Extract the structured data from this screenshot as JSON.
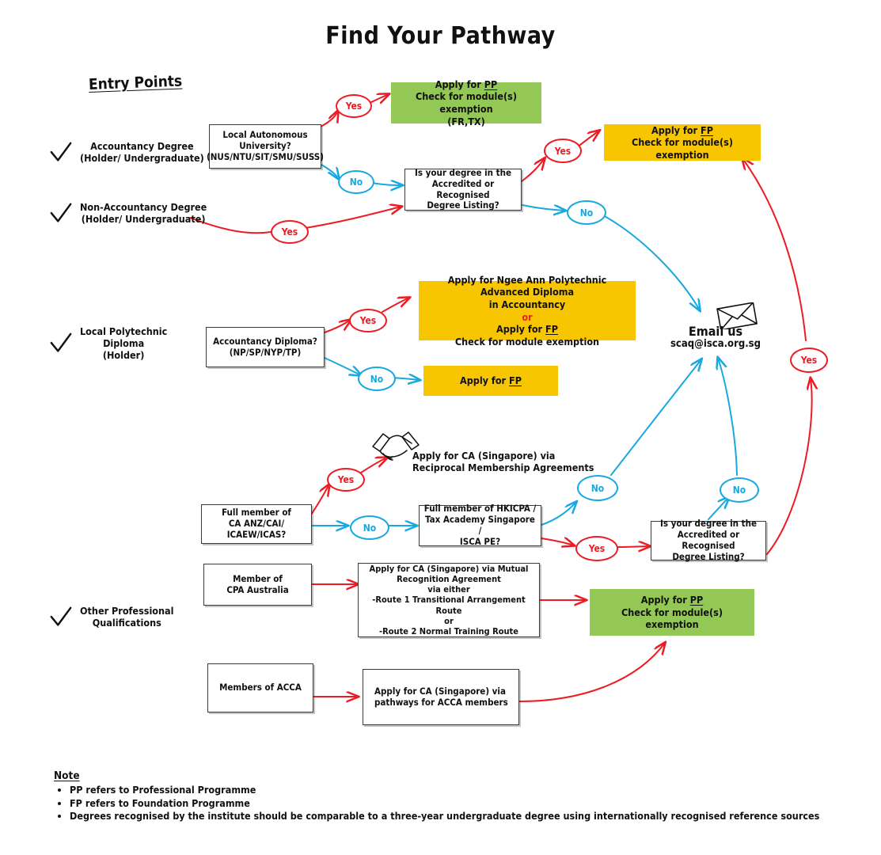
{
  "title": "Find Your Pathway",
  "entry_points_heading": "Entry Points",
  "entries": [
    {
      "id": "accountancy-degree",
      "label": "Accountancy Degree\n(Holder/ Undergraduate)"
    },
    {
      "id": "non-accountancy-degree",
      "label": "Non-Accountancy Degree\n(Holder/ Undergraduate)"
    },
    {
      "id": "local-polytechnic-diploma",
      "label": "Local Polytechnic\nDiploma\n(Holder)"
    },
    {
      "id": "other-professional-qualifications",
      "label": "Other Professional\nQualifications"
    }
  ],
  "boxes": {
    "local_autonomous_university": "Local Autonomous\nUniversity?\n(NUS/NTU/SIT/SMU/SUSS)",
    "accredited_listing_top": "Is your degree in the\nAccredited or Recognised\nDegree Listing?",
    "accountancy_diploma": "Accountancy Diploma?\n(NP/SP/NYP/TP)",
    "full_member_ca_anz": "Full member of\nCA ANZ/CAI/\nICAEW/ICAS?",
    "full_member_hkicpa": "Full member of HKICPA /\nTax Academy Singapore /\nISCA PE?",
    "member_cpa_australia": "Member of\nCPA Australia",
    "mutual_recognition": "Apply for CA (Singapore) via Mutual\nRecognition Agreement\nvia either\n-Route 1 Transitional Arrangement Route\nor\n-Route 2 Normal Training Route",
    "members_of_acca": "Members of ACCA",
    "acca_pathway": "Apply for CA (Singapore) via\npathways for ACCA members",
    "accredited_listing_bottom": "Is your degree in the\nAccredited or Recognised\nDegree Listing?"
  },
  "outcomes": {
    "pp_fr_tx": {
      "line1": "Apply for ",
      "link": "PP",
      "line2": "Check for module(s) exemption",
      "line3": "(FR,TX)",
      "color": "#93c756"
    },
    "fp_top": {
      "line1": "Apply for ",
      "link": "FP",
      "line2": "Check for module(s) exemption",
      "color": "#f7c600"
    },
    "ngee_ann": {
      "line1": "Apply for Ngee Ann Polytechnic Advanced Diploma",
      "line2": "in Accountancy",
      "or": "or",
      "line3": "Apply for ",
      "link": "FP",
      "line4": "Check for module exemption",
      "color": "#f7c600"
    },
    "fp_poly": {
      "line1": "Apply for ",
      "link": "FP",
      "color": "#f7c600"
    },
    "pp_bottom": {
      "line1": "Apply for ",
      "link": "PP",
      "line2": "Check for module(s)",
      "line3": "exemption",
      "color": "#93c756"
    }
  },
  "reciprocal_text": "Apply for CA (Singapore) via\nReciprocal Membership Agreements",
  "email": {
    "heading": "Email us",
    "address": "scaq@isca.org.sg"
  },
  "decisions": {
    "yes": "Yes",
    "no": "No"
  },
  "note": {
    "heading": "Note",
    "items": [
      "PP refers to Professional Programme",
      "FP refers to Foundation Programme",
      "Degrees recognised by the institute should be comparable to a three-year undergraduate degree using internationally recognised reference sources"
    ]
  },
  "colors": {
    "red": "#ed1c24",
    "blue": "#17a9e0",
    "green": "#93c756",
    "yellow": "#f7c600",
    "ink": "#333333"
  }
}
